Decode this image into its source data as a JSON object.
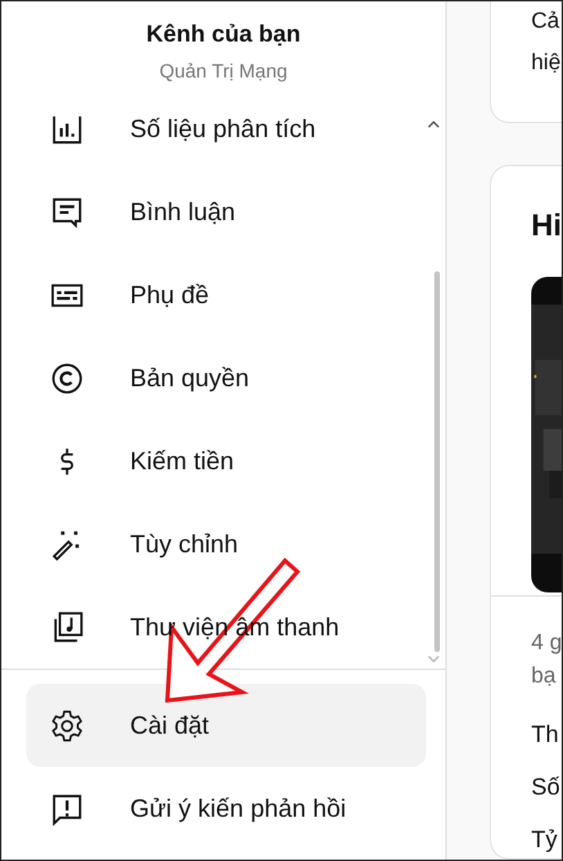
{
  "header": {
    "title": "Kênh của bạn",
    "subtitle": "Quản Trị Mạng"
  },
  "nav_items": [
    {
      "label": "Số liệu phân tích",
      "kind": "analytics",
      "selected": false
    },
    {
      "label": "Bình luận",
      "kind": "comments",
      "selected": false
    },
    {
      "label": "Phụ đề",
      "kind": "subtitles",
      "selected": false
    },
    {
      "label": "Bản quyền",
      "kind": "copyright",
      "selected": false
    },
    {
      "label": "Kiếm tiền",
      "kind": "money",
      "selected": false
    },
    {
      "label": "Tùy chỉnh",
      "kind": "customize",
      "selected": false
    },
    {
      "label": "Thư viện âm thanh",
      "kind": "audio",
      "selected": false
    }
  ],
  "bottom_items": [
    {
      "label": "Cài đặt",
      "kind": "settings",
      "selected": true
    },
    {
      "label": "Gửi ý kiến phản hồi",
      "kind": "feedback",
      "selected": false
    }
  ],
  "main": {
    "card_lines": [
      "Cả",
      "hiệ"
    ],
    "card_title": "Hi",
    "muted_lines": [
      "4 g",
      "bạ"
    ],
    "lines": [
      "Th",
      "Số",
      "Tỷ"
    ]
  }
}
